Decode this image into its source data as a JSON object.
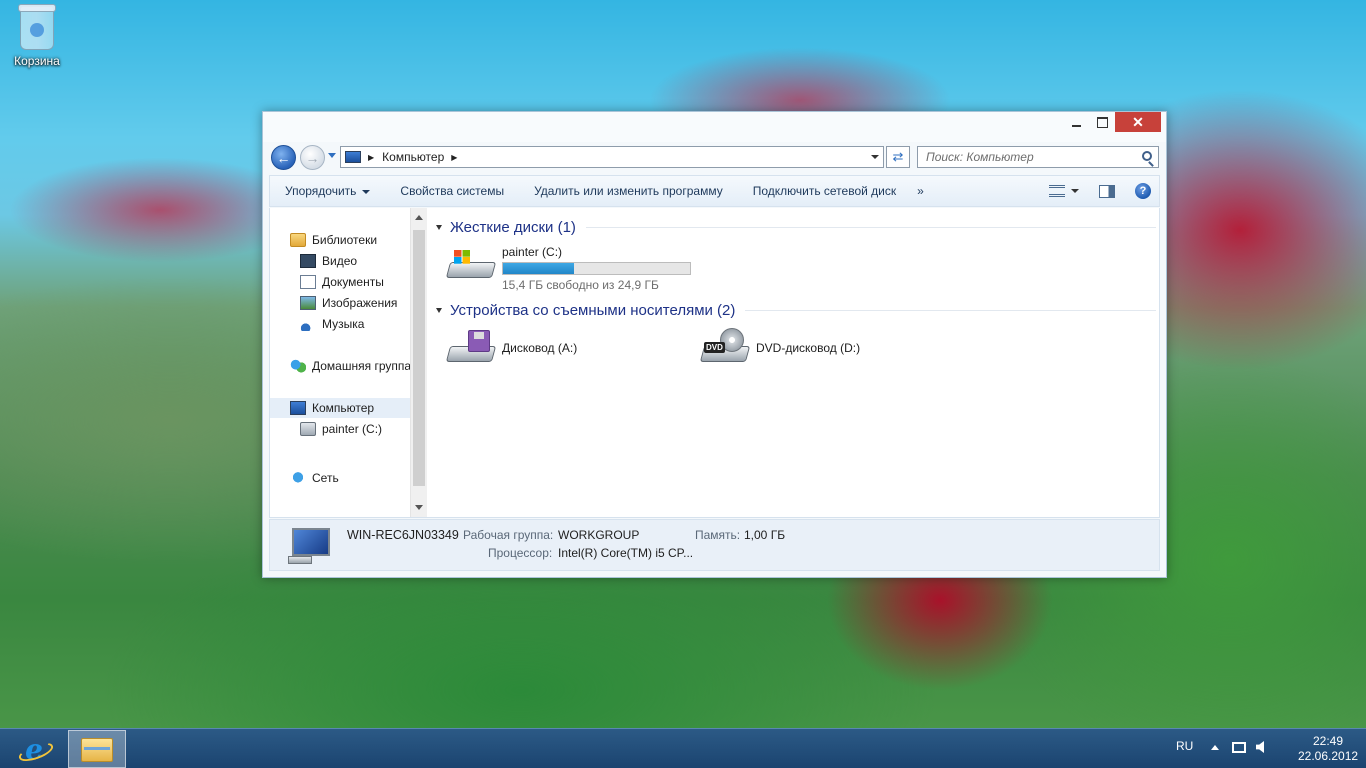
{
  "desktop": {
    "recycle_bin_label": "Корзина"
  },
  "window": {
    "close_glyph": "✕",
    "address": {
      "crumb": "Компьютер",
      "separator": "▶"
    },
    "search": {
      "placeholder": "Поиск: Компьютер"
    },
    "toolbar": {
      "organize": "Упорядочить",
      "system_properties": "Свойства системы",
      "uninstall_program": "Удалить или изменить программу",
      "map_network_drive": "Подключить сетевой диск",
      "more": "»",
      "help": "?"
    },
    "nav": {
      "libraries": "Библиотеки",
      "video": "Видео",
      "documents": "Документы",
      "images": "Изображения",
      "music": "Музыка",
      "homegroup": "Домашняя группа",
      "computer": "Компьютер",
      "drive_c": "painter (C:)",
      "network": "Сеть"
    },
    "content": {
      "hard_drives_header": "Жесткие диски (1)",
      "removable_header": "Устройства со съемными носителями (2)",
      "drive_c": {
        "name": "painter (C:)",
        "free_text": "15,4 ГБ свободно из 24,9 ГБ",
        "used_fraction": 0.38
      },
      "floppy": {
        "name": "Дисковод (A:)"
      },
      "dvd": {
        "name": "DVD-дисковод (D:)",
        "tag": "DVD"
      }
    },
    "details": {
      "computer_name": "WIN-REC6JN03349",
      "workgroup_label": "Рабочая группа:",
      "workgroup_value": "WORKGROUP",
      "memory_label": "Память:",
      "memory_value": "1,00 ГБ",
      "processor_label": "Процессор:",
      "processor_value": "Intel(R) Core(TM) i5 CP..."
    }
  },
  "taskbar": {
    "ie_glyph": "e",
    "language": "RU",
    "time": "22:49",
    "date": "22.06.2012"
  },
  "colors": {
    "accent": "#2186c8",
    "close_button": "#c7413a",
    "group_header": "#1e3287",
    "taskbar": "#1b4470"
  }
}
